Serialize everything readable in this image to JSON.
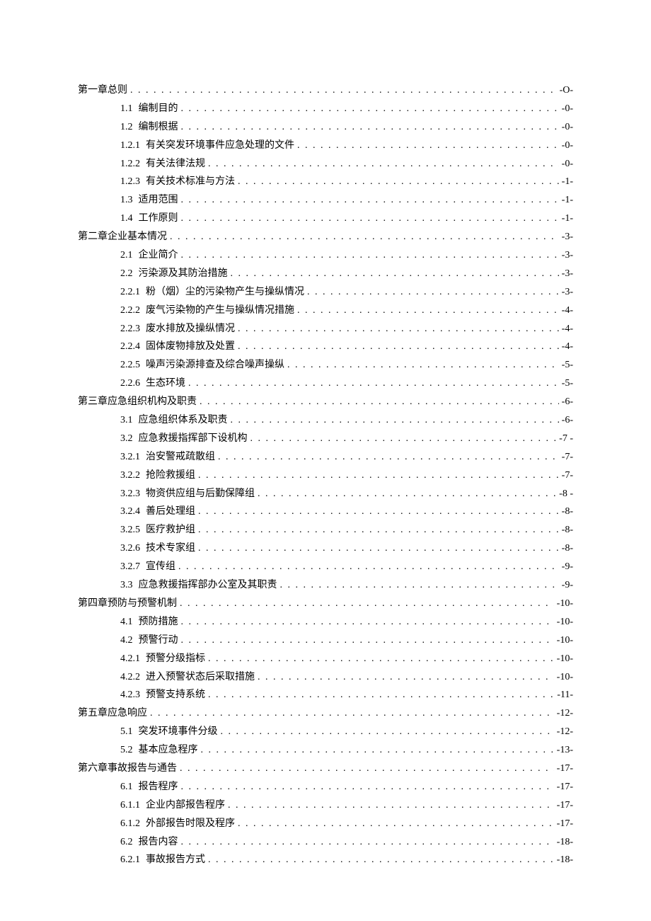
{
  "toc": [
    {
      "level": 1,
      "num": "",
      "title": "第一章总则",
      "page": "-O-"
    },
    {
      "level": 2,
      "num": "1.1",
      "title": "编制目的",
      "page": "-0-"
    },
    {
      "level": 2,
      "num": "1.2",
      "title": "编制根据",
      "page": "-0-"
    },
    {
      "level": 3,
      "num": "1.2.1",
      "title": "有关突发环境事件应急处理的文件",
      "page": "-0-"
    },
    {
      "level": 3,
      "num": "1.2.2",
      "title": "有关法律法规",
      "page": "-0-"
    },
    {
      "level": 3,
      "num": "1.2.3",
      "title": "有关技术标准与方法",
      "page": "-1-"
    },
    {
      "level": 2,
      "num": "1.3",
      "title": "适用范围",
      "page": "-1-"
    },
    {
      "level": 2,
      "num": "1.4",
      "title": "工作原则",
      "page": "-1-"
    },
    {
      "level": 1,
      "num": "",
      "title": "第二章企业基本情况",
      "page": "-3-"
    },
    {
      "level": 2,
      "num": "2.1",
      "title": "企业简介",
      "page": "-3-"
    },
    {
      "level": 2,
      "num": "2.2",
      "title": "污染源及其防治措施",
      "page": "-3-"
    },
    {
      "level": 3,
      "num": "2.2.1",
      "title": "粉（烟）尘的污染物产生与操纵情况",
      "page": "-3-"
    },
    {
      "level": 3,
      "num": "2.2.2",
      "title": "废气污染物的产生与操纵情况措施",
      "page": "-4-"
    },
    {
      "level": 3,
      "num": "2.2.3",
      "title": "废水排放及操纵情况",
      "page": "-4-"
    },
    {
      "level": 3,
      "num": "2.2.4",
      "title": "固体废物排放及处置",
      "page": "-4-"
    },
    {
      "level": 3,
      "num": "2.2.5",
      "title": "噪声污染源排查及综合噪声操纵",
      "page": "-5-"
    },
    {
      "level": 3,
      "num": "2.2.6",
      "title": "生态环境",
      "page": "-5-"
    },
    {
      "level": 1,
      "num": "",
      "title": "第三章应急组织机构及职责",
      "page": "-6-"
    },
    {
      "level": 2,
      "num": "3.1",
      "title": "应急组织体系及职责",
      "page": "-6-"
    },
    {
      "level": 2,
      "num": "3.2",
      "title": "应急救援指挥部下设机构",
      "page": "-7  -"
    },
    {
      "level": 3,
      "num": "3.2.1",
      "title": "治安警戒疏散组",
      "page": "-7-"
    },
    {
      "level": 3,
      "num": "3.2.2",
      "title": "抢险救援组",
      "page": "-7-"
    },
    {
      "level": 3,
      "num": "3.2.3",
      "title": "物资供应组与后勤保障组",
      "page": "-8  -"
    },
    {
      "level": 3,
      "num": "3.2.4",
      "title": "善后处理组",
      "page": "-8-"
    },
    {
      "level": 3,
      "num": "3.2.5",
      "title": "医疗救护组",
      "page": "-8-"
    },
    {
      "level": 3,
      "num": "3.2.6",
      "title": "技术专家组",
      "page": "-8-"
    },
    {
      "level": 3,
      "num": "3.2.7",
      "title": "宣传组",
      "page": "-9-"
    },
    {
      "level": 2,
      "num": "3.3",
      "title": "应急救援指挥部办公室及其职责",
      "page": "-9-"
    },
    {
      "level": 1,
      "num": "",
      "title": "第四章预防与预警机制",
      "page": "-10-"
    },
    {
      "level": 2,
      "num": "4.1",
      "title": "预防措施",
      "page": "-10-"
    },
    {
      "level": 2,
      "num": "4.2",
      "title": "预警行动",
      "page": "-10-"
    },
    {
      "level": 3,
      "num": "4.2.1",
      "title": "预警分级指标",
      "page": "-10-"
    },
    {
      "level": 3,
      "num": "4.2.2",
      "title": "进入预警状态后采取措施",
      "page": "-10-"
    },
    {
      "level": 3,
      "num": "4.2.3",
      "title": "预警支持系统",
      "page": "-11-"
    },
    {
      "level": 1,
      "num": "",
      "title": "第五章应急响应",
      "page": "-12-"
    },
    {
      "level": 2,
      "num": "5.1",
      "title": "突发环境事件分级",
      "page": "-12-"
    },
    {
      "level": 2,
      "num": "5.2",
      "title": "基本应急程序",
      "page": "-13-"
    },
    {
      "level": 1,
      "num": "",
      "title": "第六章事故报告与通告",
      "page": "-17-"
    },
    {
      "level": 2,
      "num": "6.1",
      "title": "报告程序",
      "page": "-17-"
    },
    {
      "level": 3,
      "num": "6.1.1",
      "title": "企业内部报告程序",
      "page": "-17-"
    },
    {
      "level": 3,
      "num": "6.1.2",
      "title": "外部报告时限及程序",
      "page": "-17-"
    },
    {
      "level": 2,
      "num": "6.2",
      "title": "报告内容",
      "page": "-18-"
    },
    {
      "level": 3,
      "num": "6.2.1",
      "title": "事故报告方式",
      "page": "-18-"
    }
  ]
}
